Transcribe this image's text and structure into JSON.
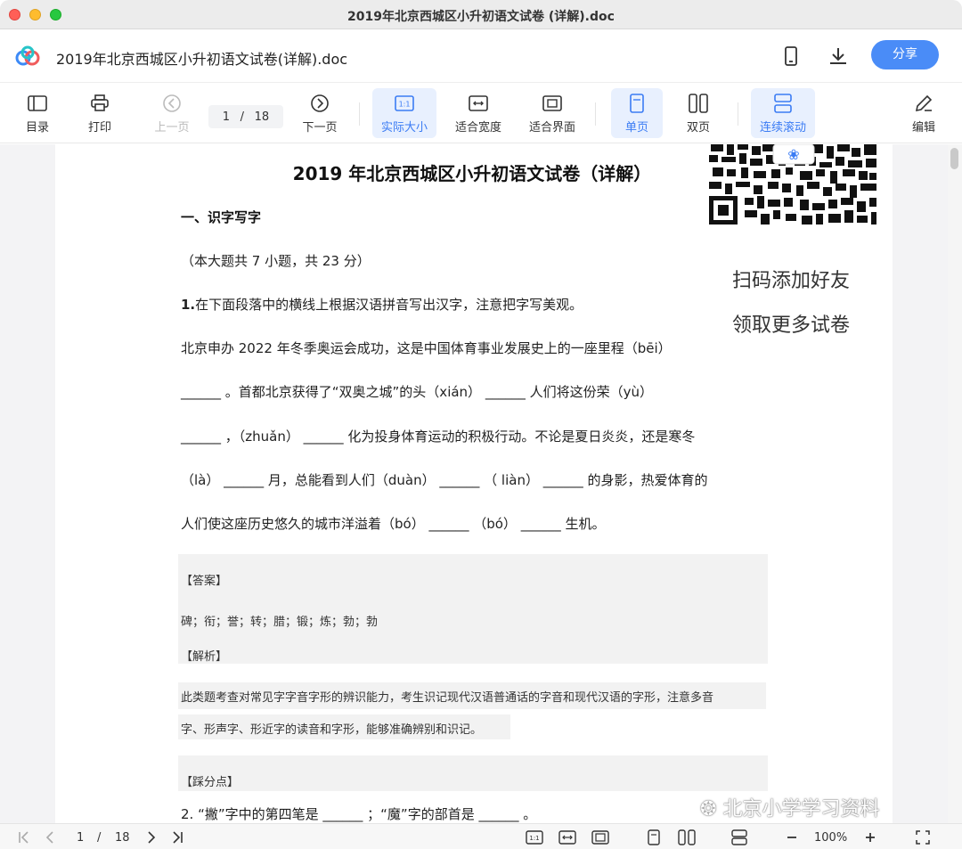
{
  "window": {
    "title": "2019年北京西城区小升初语文试卷 (详解).doc"
  },
  "header": {
    "doc_title": "2019年北京西城区小升初语文试卷(详解).doc",
    "share_label": "分享",
    "icons": [
      "phone-icon",
      "download-icon"
    ]
  },
  "toolbar": {
    "toc": "目录",
    "print": "打印",
    "prev": "上一页",
    "page_current": "1",
    "page_sep": "/",
    "page_total": "18",
    "next": "下一页",
    "actual_size": "实际大小",
    "fit_width": "适合宽度",
    "fit_screen": "适合界面",
    "single": "单页",
    "double": "双页",
    "continuous": "连续滚动",
    "edit": "编辑"
  },
  "document": {
    "title": "2019 年北京西城区小升初语文试卷（详解）",
    "section1": "一、识字写字",
    "section1_info": "（本大题共 7 小题，共 23 分）",
    "q1_num": "1.",
    "q1_text": "在下面段落中的横线上根据汉语拼音写出汉字，注意把字写美观。",
    "q1_lines": [
      "北京申办 2022 年冬季奥运会成功，这是中国体育事业发展史上的一座里程（bēi）",
      " ______ 。首都北京获得了“双奥之城”的头（xián） ______ 人们将这份荣（yù）",
      " ______ ，（zhuǎn） ______ 化为投身体育运动的积极行动。不论是夏日炎炎，还是寒冬",
      "（là） ______ 月，总能看到人们（duàn） ______ （ liàn） ______ 的身影，热爱体育的",
      "人们使这座历史悠久的城市洋溢着（bó） ______ （bó） ______ 生机。"
    ],
    "answer_label": "【答案】",
    "answer_text": "碑；衔；誉；转；腊；锻；炼；勃；勃",
    "analysis_label": "【解析】",
    "analysis_lines": [
      "此类题考查对常见字字音字形的辨识能力，考生识记现代汉语普通话的字音和现代汉语的字形，注意多音",
      "字、形声字、形近字的读音和字形，能够准确辨别和识记。"
    ],
    "points_label": "【踩分点】",
    "q2_text": "2.  “撇”字中的第四笔是 ______ ；“魔”字的部首是 ______ 。",
    "qr_line1": "扫码添加好友",
    "qr_line2": "领取更多试卷"
  },
  "bottombar": {
    "page_current": "1",
    "page_sep": "/",
    "page_total": "18",
    "zoom": "100%"
  },
  "watermark": "北京小学学习资料"
}
